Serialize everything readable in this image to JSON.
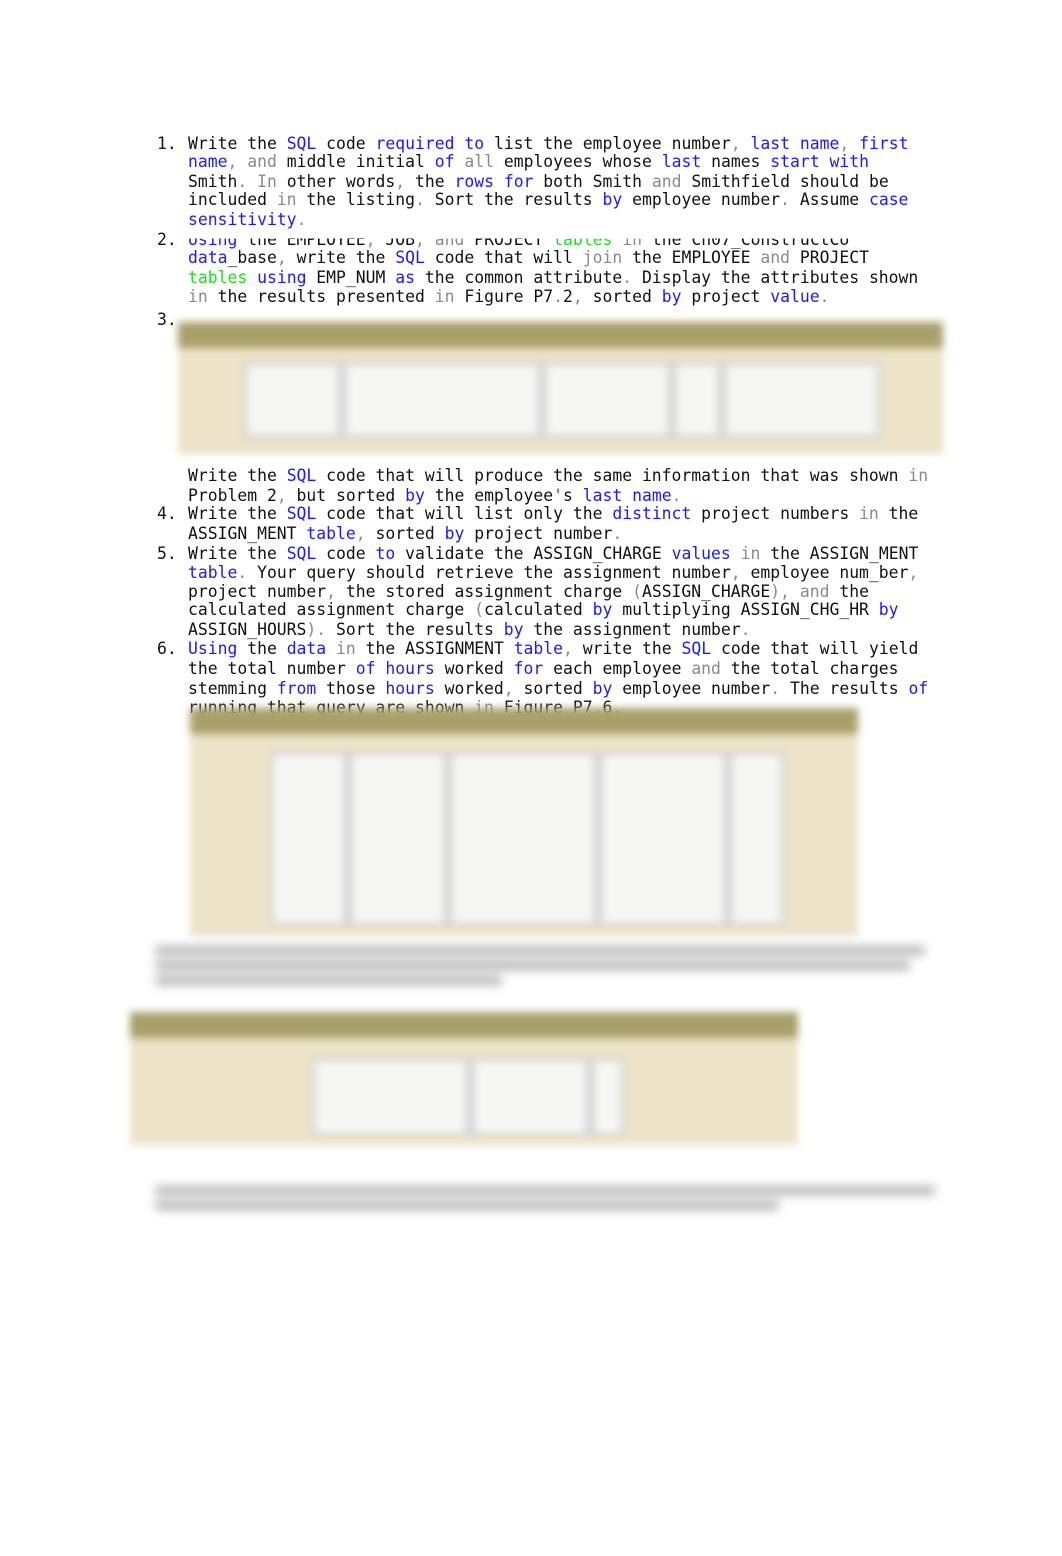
{
  "items": [
    {
      "number": "1.",
      "lines": [
        "Write the {SQL} code {required to} list the employee number, {last name}, {first}",
        "{name}, [and] middle initial {of} [all] employees whose {last} names {start with}",
        "Smith. [In] other words, the {rows for} both Smith [and] Smithfield should be",
        "included [in] the listing. Sort the results {by} employee number. Assume {case}",
        "{sensitivity}."
      ]
    },
    {
      "number": "2.",
      "lines": [
        "{Using} the EMPLOYEE, JOB, [and] PROJECT <tables> [in] the Ch07_ConstructCo",
        "{data}_base, write the {SQL} code that will [join] the EMPLOYEE [and] PROJECT",
        "<tables> {using} EMP_NUM {as} the common attribute. Display the attributes shown",
        "[in] the results presented [in] Figure P7.2, sorted {by} project {value}."
      ]
    },
    {
      "number": "3.",
      "lines": [
        "Write the {SQL} code that will produce the same information that was shown [in]",
        "Problem 2, but sorted {by} the employee^'^s {last name}."
      ]
    },
    {
      "number": "4.",
      "lines": [
        "Write the {SQL} code that will list only the {distinct} project numbers [in] the",
        "ASSIGN_MENT {table}, sorted {by} project number."
      ]
    },
    {
      "number": "5.",
      "lines": [
        "Write the {SQL} code {to} validate the ASSIGN_CHARGE {values} [in] the ASSIGN_MENT",
        "{table}. Your query should retrieve the assignment number, employee num_ber,",
        "project number, the stored assignment charge (ASSIGN_CHARGE), [and] the",
        "calculated assignment charge (calculated {by} multiplying ASSIGN_CHG_HR {by}",
        "ASSIGN_HOURS). Sort the results {by} the assignment number."
      ]
    },
    {
      "number": "6.",
      "lines": [
        "{Using} the {data} [in] the ASSIGNMENT {table}, write the {SQL} code that will yield",
        "the total number {of hours} worked {for} each employee [and] the total charges",
        "stemming {from} those {hours} worked, sorted {by} employee number. The results {of}",
        "running that query are shown [in] Figure P7.6."
      ]
    }
  ],
  "colors": {
    "keyword": "#1a1aff",
    "muted": "#8a8a8a",
    "table_keyword": "#22dd22",
    "apostrophe": "#e02020",
    "figure_bg": "#ece3c8",
    "figure_bar": "#a9a06a"
  }
}
